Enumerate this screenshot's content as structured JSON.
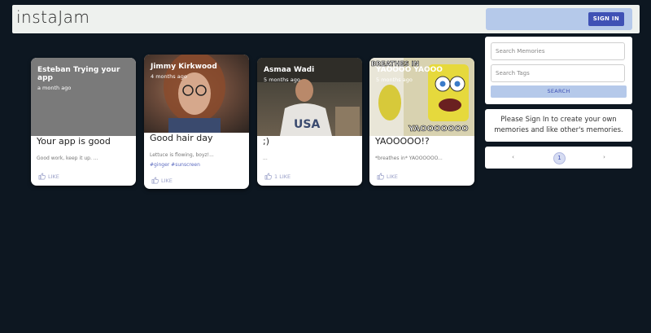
{
  "app": {
    "title": "instaJam"
  },
  "auth": {
    "signin_label": "SIGN IN"
  },
  "memories": [
    {
      "author": "Esteban Trying your app",
      "time": "a month ago",
      "title": "Your app is good",
      "message": "Good work, keep it up. ...",
      "tags": "",
      "likes": "LIKE",
      "media_color": "#7a7a7a"
    },
    {
      "author": "Jimmy Kirkwood",
      "time": "4 months ago",
      "title": "Good hair day",
      "message": "Lettuce is flowing, boyz!...",
      "tags": "#ginger #sunscreen",
      "likes": "LIKE",
      "media_color": "#6b4a3a"
    },
    {
      "author": "Asmaa Wadi",
      "time": "5 months ago",
      "title": ";)",
      "message": "...",
      "tags": "",
      "likes": "1 LIKE",
      "media_color": "#5e5446"
    },
    {
      "author": "YAOOOO YAOOO",
      "time": "5 months ago",
      "title": "YAOOOOO!?",
      "message": "*breathes in* YAOOOOOO...",
      "tags": "",
      "likes": "LIKE",
      "media_color": "#c9b53a",
      "meme_text": "YAOOOOOOO",
      "meme_top": "BREATHES IN"
    }
  ],
  "search": {
    "memories_placeholder": "Search Memories",
    "tags_placeholder": "Search Tags",
    "button_label": "SEARCH"
  },
  "info": {
    "text": "Please Sign In to create your own memories and like other's memories."
  },
  "pagination": {
    "prev": "‹",
    "current": "1",
    "next": "›"
  },
  "colors": {
    "background": "#0d1721",
    "accent": "#3f51b5",
    "accent_light": "#b5c9ea"
  }
}
